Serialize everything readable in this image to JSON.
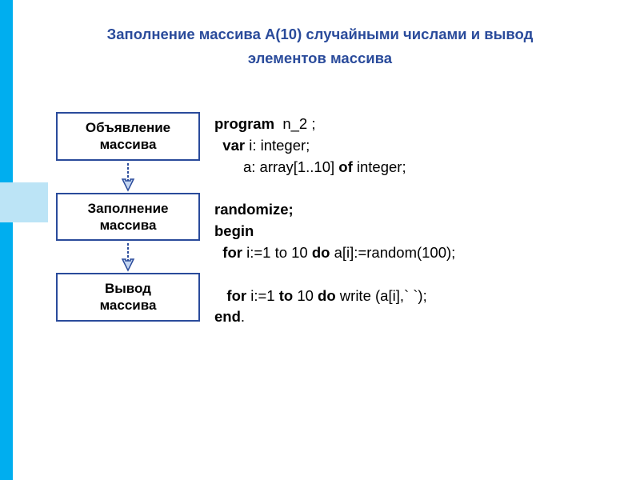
{
  "title": {
    "line1": "Заполнение массива A(10) случайными числами и вывод",
    "line2": "элементов массива"
  },
  "flow": {
    "box1_line1": "Объявление",
    "box1_line2": "массива",
    "box2_line1": "Заполнение",
    "box2_line2": "массива",
    "box3_line1": "Вывод",
    "box3_line2": "массива"
  },
  "code": {
    "kw_program": "program",
    "program_name": "  n_2 ;",
    "kw_var": "  var",
    "var_decl": " i: integer;",
    "arr_decl_pre": "       a: array[1..10] ",
    "kw_of": "of",
    "arr_decl_post": " integer;",
    "kw_randomize": "randomize;",
    "kw_begin": "begin",
    "kw_for1": "  for",
    "for1_mid": " i:=1 to 10 ",
    "kw_do1": "do",
    "for1_body": " a[i]:=random(100);",
    "kw_for2": "   for",
    "for2_i": " i:=1 ",
    "kw_to2": "to",
    "for2_range": " 10 ",
    "kw_do2": "do",
    "for2_body": " write (a[i],` `);",
    "kw_end": "end",
    "end_dot": "."
  }
}
